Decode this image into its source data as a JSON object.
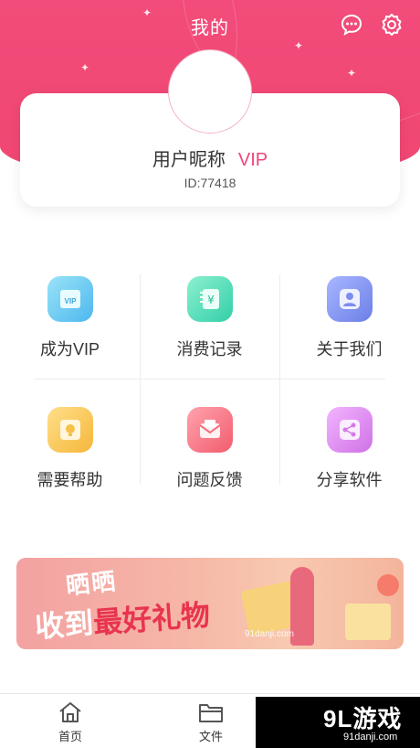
{
  "header": {
    "title": "我的",
    "accent": "#f24c7a"
  },
  "profile": {
    "nickname": "用户昵称",
    "vip_badge": "VIP",
    "user_id": "ID:77418"
  },
  "menu": {
    "items": [
      {
        "label": "成为VIP",
        "icon": "vip-card-icon",
        "color": "#56c3f0"
      },
      {
        "label": "消费记录",
        "icon": "receipt-icon",
        "color": "#3fd5b0"
      },
      {
        "label": "关于我们",
        "icon": "person-icon",
        "color": "#7b8df0"
      },
      {
        "label": "需要帮助",
        "icon": "lightbulb-icon",
        "color": "#f7c04a"
      },
      {
        "label": "问题反馈",
        "icon": "mail-icon",
        "color": "#f56a7a"
      },
      {
        "label": "分享软件",
        "icon": "share-icon",
        "color": "#d57be6"
      }
    ]
  },
  "banner": {
    "line1": "晒晒",
    "line2_prefix": "收到",
    "line2_highlight": "最好礼物",
    "watermark": "91danji.com"
  },
  "bottom_nav": {
    "home_label": "首页",
    "files_label": "文件"
  },
  "brand": {
    "name": "9L游戏",
    "url": "91danji.com"
  }
}
